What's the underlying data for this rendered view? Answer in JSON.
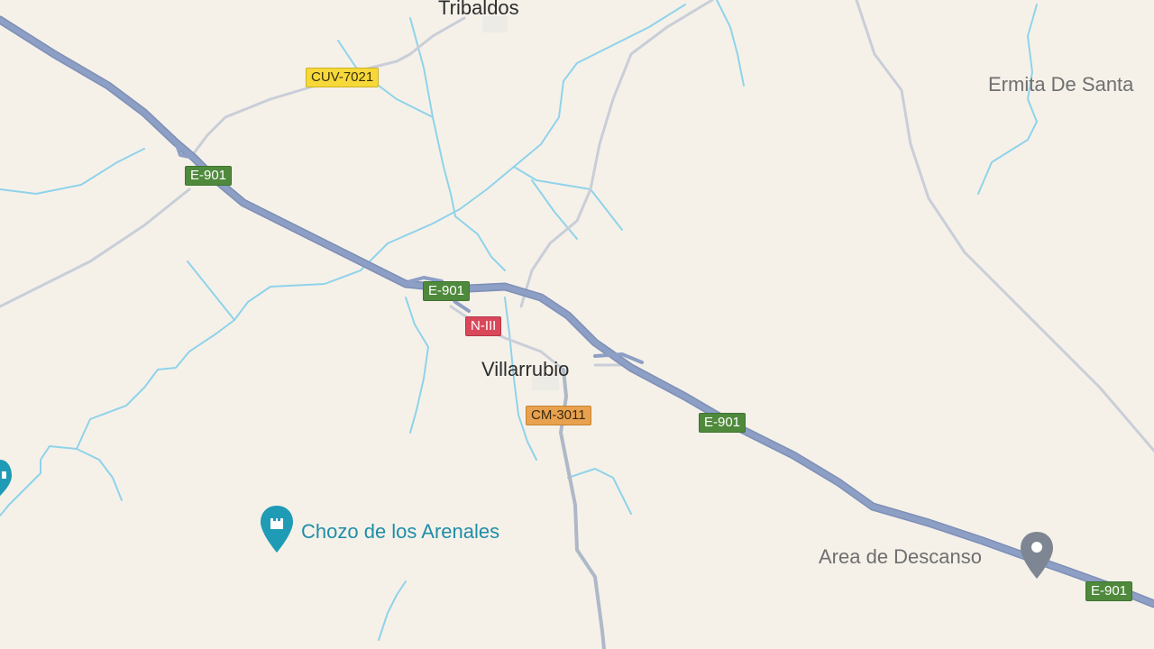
{
  "colors": {
    "background": "#f5f1e9",
    "highway": "#8d9fc5",
    "highway_outline": "#7d8fb6",
    "local_road": "#c9ced8",
    "water": "#8fd3ea",
    "poi_teal": "#1f8ea8",
    "poi_grey": "#6f6f6f"
  },
  "places": {
    "tribaldos": "Tribaldos",
    "villarrubio": "Villarrubio",
    "ermita": "Ermita De Santa",
    "chozo": "Chozo de los Arenales",
    "area_descanso": "Area de Descanso"
  },
  "roads": {
    "e901": "E-901",
    "cuv7021": "CUV-7021",
    "n3": "N-III",
    "cm3011": "CM-3011"
  },
  "icons": {
    "chozo": "tower-marker-icon",
    "area_descanso": "location-pin-icon",
    "edge_poi": "partial-marker-icon"
  }
}
